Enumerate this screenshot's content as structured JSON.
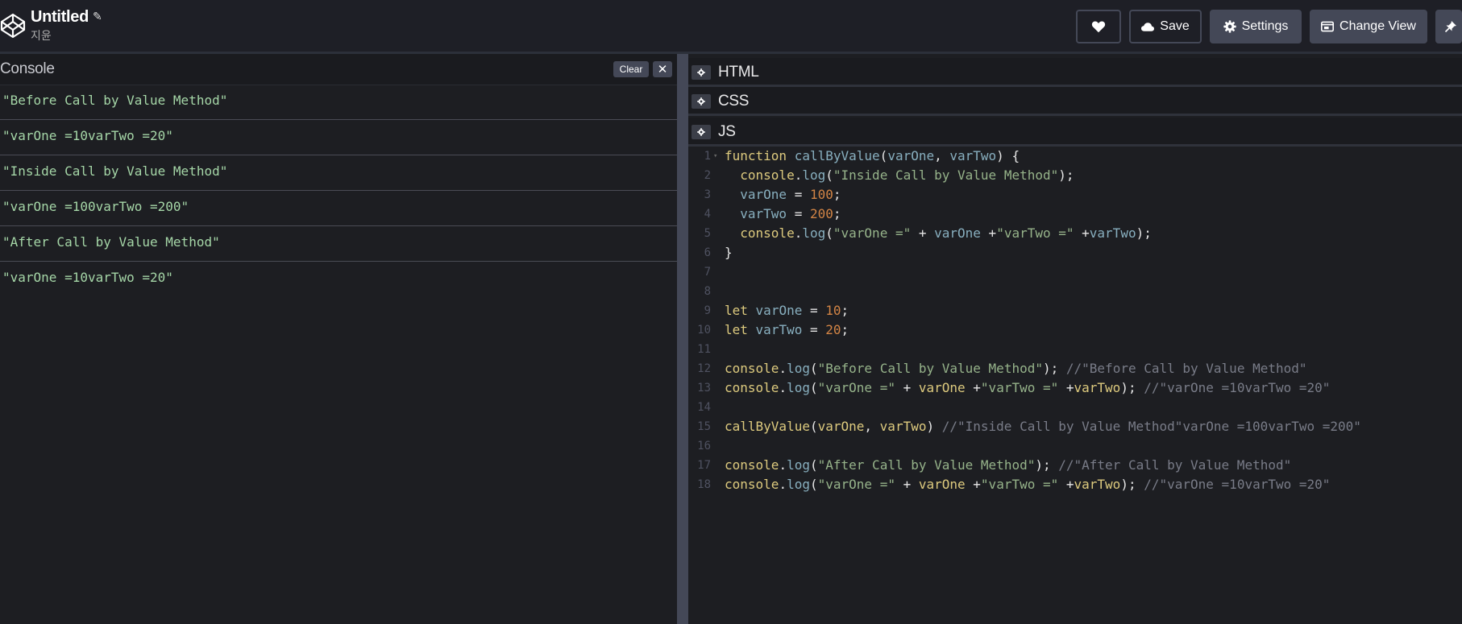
{
  "header": {
    "title": "Untitled",
    "author": "지윤",
    "buttons": {
      "save": "Save",
      "settings": "Settings",
      "change_view": "Change View"
    }
  },
  "console": {
    "title": "Console",
    "clear_label": "Clear",
    "close_label": "✕",
    "rows": [
      "\"Before Call by Value Method\"",
      "\"varOne =10varTwo =20\"",
      "\"Inside Call by Value Method\"",
      "\"varOne =100varTwo =200\"",
      "\"After Call by Value Method\"",
      "\"varOne =10varTwo =20\""
    ]
  },
  "editors": {
    "html_title": "HTML",
    "css_title": "CSS",
    "js_title": "JS"
  },
  "code": {
    "line_numbers": [
      "1",
      "2",
      "3",
      "4",
      "5",
      "6",
      "7",
      "8",
      "9",
      "10",
      "11",
      "12",
      "13",
      "14",
      "15",
      "16",
      "17",
      "18"
    ],
    "lines": [
      [
        [
          "k",
          "function"
        ],
        [
          "p",
          " "
        ],
        [
          "v",
          "callByValue"
        ],
        [
          "p",
          "("
        ],
        [
          "v",
          "varOne"
        ],
        [
          "p",
          ", "
        ],
        [
          "v",
          "varTwo"
        ],
        [
          "p",
          ") {"
        ]
      ],
      [
        [
          "p",
          "  "
        ],
        [
          "fn",
          "console"
        ],
        [
          "p",
          "."
        ],
        [
          "v",
          "log"
        ],
        [
          "p",
          "("
        ],
        [
          "s",
          "\"Inside Call by Value Method\""
        ],
        [
          "p",
          ");"
        ]
      ],
      [
        [
          "p",
          "  "
        ],
        [
          "v",
          "varOne"
        ],
        [
          "p",
          " = "
        ],
        [
          "n",
          "100"
        ],
        [
          "p",
          ";"
        ]
      ],
      [
        [
          "p",
          "  "
        ],
        [
          "v",
          "varTwo"
        ],
        [
          "p",
          " = "
        ],
        [
          "n",
          "200"
        ],
        [
          "p",
          ";"
        ]
      ],
      [
        [
          "p",
          "  "
        ],
        [
          "fn",
          "console"
        ],
        [
          "p",
          "."
        ],
        [
          "v",
          "log"
        ],
        [
          "p",
          "("
        ],
        [
          "s",
          "\"varOne =\""
        ],
        [
          "p",
          " + "
        ],
        [
          "v",
          "varOne"
        ],
        [
          "p",
          " +"
        ],
        [
          "s",
          "\"varTwo =\""
        ],
        [
          "p",
          " +"
        ],
        [
          "v",
          "varTwo"
        ],
        [
          "p",
          ");"
        ]
      ],
      [
        [
          "p",
          "}"
        ]
      ],
      [],
      [],
      [
        [
          "k",
          "let"
        ],
        [
          "p",
          " "
        ],
        [
          "v",
          "varOne"
        ],
        [
          "p",
          " = "
        ],
        [
          "n",
          "10"
        ],
        [
          "p",
          ";"
        ]
      ],
      [
        [
          "k",
          "let"
        ],
        [
          "p",
          " "
        ],
        [
          "v",
          "varTwo"
        ],
        [
          "p",
          " = "
        ],
        [
          "n",
          "20"
        ],
        [
          "p",
          ";"
        ]
      ],
      [],
      [
        [
          "fn",
          "console"
        ],
        [
          "p",
          "."
        ],
        [
          "v",
          "log"
        ],
        [
          "p",
          "("
        ],
        [
          "s",
          "\"Before Call by Value Method\""
        ],
        [
          "p",
          "); "
        ],
        [
          "c",
          "//\"Before Call by Value Method\""
        ]
      ],
      [
        [
          "fn",
          "console"
        ],
        [
          "p",
          "."
        ],
        [
          "v",
          "log"
        ],
        [
          "p",
          "("
        ],
        [
          "s",
          "\"varOne =\""
        ],
        [
          "p",
          " + "
        ],
        [
          "vb",
          "varOne"
        ],
        [
          "p",
          " +"
        ],
        [
          "s",
          "\"varTwo =\""
        ],
        [
          "p",
          " +"
        ],
        [
          "vb",
          "varTwo"
        ],
        [
          "p",
          "); "
        ],
        [
          "c",
          "//\"varOne =10varTwo =20\""
        ]
      ],
      [],
      [
        [
          "fn",
          "callByValue"
        ],
        [
          "p",
          "("
        ],
        [
          "vb",
          "varOne"
        ],
        [
          "p",
          ", "
        ],
        [
          "vb",
          "varTwo"
        ],
        [
          "p",
          ") "
        ],
        [
          "c",
          "//\"Inside Call by Value Method\"varOne =100varTwo =200\""
        ]
      ],
      [],
      [
        [
          "fn",
          "console"
        ],
        [
          "p",
          "."
        ],
        [
          "v",
          "log"
        ],
        [
          "p",
          "("
        ],
        [
          "s",
          "\"After Call by Value Method\""
        ],
        [
          "p",
          "); "
        ],
        [
          "c",
          "//\"After Call by Value Method\""
        ]
      ],
      [
        [
          "fn",
          "console"
        ],
        [
          "p",
          "."
        ],
        [
          "v",
          "log"
        ],
        [
          "p",
          "("
        ],
        [
          "s",
          "\"varOne =\""
        ],
        [
          "p",
          " + "
        ],
        [
          "vb",
          "varOne"
        ],
        [
          "p",
          " +"
        ],
        [
          "s",
          "\"varTwo =\""
        ],
        [
          "p",
          " +"
        ],
        [
          "vb",
          "varTwo"
        ],
        [
          "p",
          "); "
        ],
        [
          "c",
          "//\"varOne =10varTwo =20\""
        ]
      ]
    ]
  }
}
